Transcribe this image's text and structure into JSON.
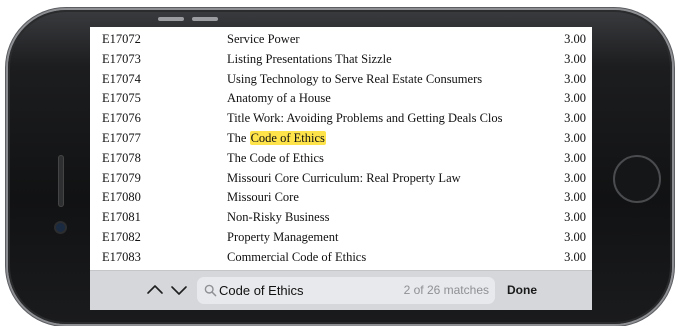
{
  "courses": [
    {
      "code": "E17072",
      "title": "Service Power",
      "hours": "3.00"
    },
    {
      "code": "E17073",
      "title": "Listing Presentations That Sizzle",
      "hours": "3.00"
    },
    {
      "code": "E17074",
      "title": "Using Technology to Serve Real Estate Consumers",
      "hours": "3.00"
    },
    {
      "code": "E17075",
      "title": "Anatomy of a House",
      "hours": "3.00"
    },
    {
      "code": "E17076",
      "title": "Title Work: Avoiding Problems and Getting Deals Clos",
      "hours": "3.00"
    },
    {
      "code": "E17077",
      "title_prefix": "The ",
      "title_highlight": "Code of Ethics",
      "hours": "3.00"
    },
    {
      "code": "E17078",
      "title": "The Code of Ethics",
      "hours": "3.00"
    },
    {
      "code": "E17079",
      "title": "Missouri Core Curriculum: Real Property Law",
      "hours": "3.00"
    },
    {
      "code": "E17080",
      "title": "Missouri Core",
      "hours": "3.00"
    },
    {
      "code": "E17081",
      "title": "Non-Risky Business",
      "hours": "3.00"
    },
    {
      "code": "E17082",
      "title": "Property Management",
      "hours": "3.00"
    },
    {
      "code": "E17083",
      "title": "Commercial Code of Ethics",
      "hours": "3.00"
    }
  ],
  "find_bar": {
    "query": "Code of Ethics",
    "match_status": "2 of 26 matches",
    "done_label": "Done",
    "up_icon": "chevron-up-icon",
    "down_icon": "chevron-down-icon",
    "search_icon": "magnifier-icon"
  },
  "colors": {
    "highlight": "#ffe34a",
    "find_bar_bg": "#d5d7db",
    "phone_body": "#111213"
  }
}
